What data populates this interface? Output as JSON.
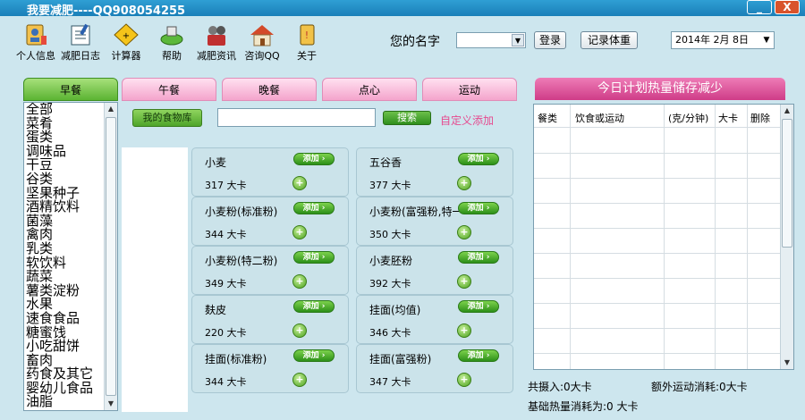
{
  "window": {
    "title": "我要减肥----QQ908054255",
    "minimize": "_",
    "close": "X"
  },
  "toolbar": {
    "items": [
      {
        "label": "个人信息",
        "icon": "personal-info-icon"
      },
      {
        "label": "减肥日志",
        "icon": "diet-log-icon"
      },
      {
        "label": "计算器",
        "icon": "calculator-icon"
      },
      {
        "label": "帮助",
        "icon": "help-icon"
      },
      {
        "label": "减肥资讯",
        "icon": "diet-news-icon"
      },
      {
        "label": "咨询QQ",
        "icon": "consult-qq-icon"
      },
      {
        "label": "关于",
        "icon": "about-icon"
      }
    ]
  },
  "user": {
    "name_label": "您的名字",
    "name_value": "",
    "login_label": "登录",
    "record_weight_label": "记录体重",
    "date_value": "2014年 2月 8日"
  },
  "meal_tabs": [
    "早餐",
    "午餐",
    "晚餐",
    "点心",
    "运动"
  ],
  "categories": [
    "全部",
    "菜肴",
    "蛋类",
    "调味品",
    "干豆",
    "谷类",
    "坚果种子",
    "酒精饮料",
    "菌藻",
    "禽肉",
    "乳类",
    "软饮料",
    "蔬菜",
    "薯类淀粉",
    "水果",
    "速食食品",
    "糖蜜饯",
    "小吃甜饼",
    "畜肉",
    "药食及其它",
    "婴幼儿食品",
    "油脂"
  ],
  "food_search": {
    "my_library_label": "我的食物库",
    "search_value": "",
    "search_label": "搜索",
    "custom_add_label": "自定义添加"
  },
  "foods": [
    {
      "name": "小麦",
      "kcal": "317 大卡",
      "add_label": "添加 ›"
    },
    {
      "name": "五谷香",
      "kcal": "377 大卡",
      "add_label": "添加 ›"
    },
    {
      "name": "小麦粉(标准粉)",
      "kcal": "344 大卡",
      "add_label": "添加 ›"
    },
    {
      "name": "小麦粉(富强粉,特一粉)",
      "kcal": "350 大卡",
      "add_label": "添加 ›"
    },
    {
      "name": "小麦粉(特二粉)",
      "kcal": "349 大卡",
      "add_label": "添加 ›"
    },
    {
      "name": "小麦胚粉",
      "kcal": "392 大卡",
      "add_label": "添加 ›"
    },
    {
      "name": "麸皮",
      "kcal": "220 大卡",
      "add_label": "添加 ›"
    },
    {
      "name": "挂面(均值)",
      "kcal": "346 大卡",
      "add_label": "添加 ›"
    },
    {
      "name": "挂面(标准粉)",
      "kcal": "344 大卡",
      "add_label": "添加 ›"
    },
    {
      "name": "挂面(富强粉)",
      "kcal": "347 大卡",
      "add_label": "添加 ›"
    }
  ],
  "plan": {
    "title": "今日计划热量储存减少",
    "columns": [
      "餐类",
      "饮食或运动",
      "(克/分钟)",
      "大卡",
      "删除"
    ]
  },
  "stats": {
    "intake": "共摄入:0大卡",
    "extra_burn": "额外运动消耗:0大卡",
    "base_burn": "基础热量消耗为:0 大卡"
  }
}
